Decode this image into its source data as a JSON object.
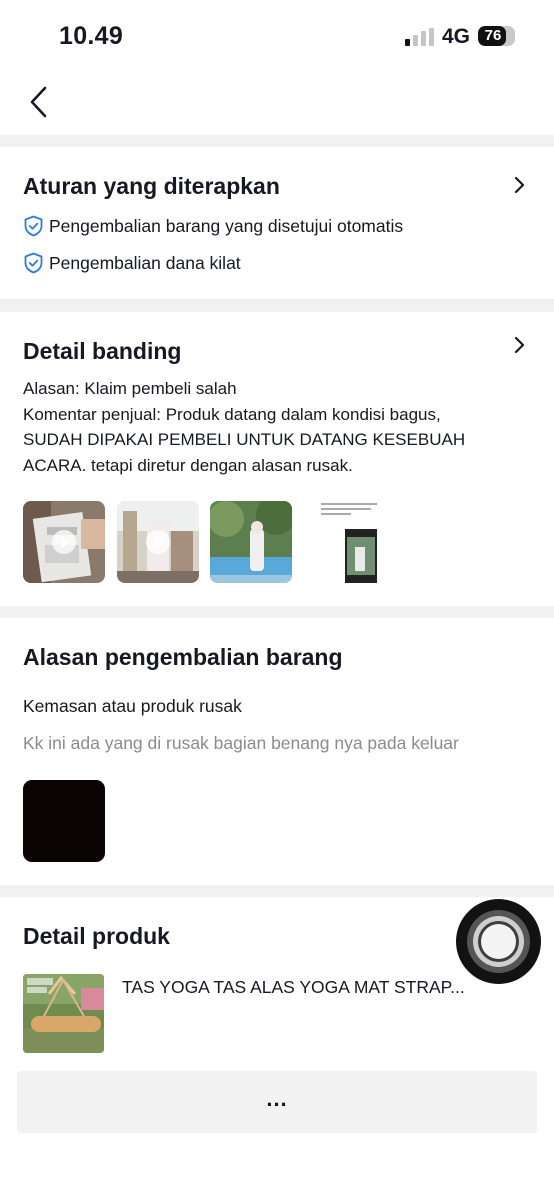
{
  "status_bar": {
    "time": "10.49",
    "network": "4G",
    "battery": "76",
    "battery_level": 0.76
  },
  "colors": {
    "accent_blue": "#2e7be0",
    "text": "#161823",
    "muted": "#8a8b91"
  },
  "rules_card": {
    "title": "Aturan yang diterapkan",
    "items": [
      {
        "icon": "shield-check-icon",
        "label": "Pengembalian barang yang disetujui otomatis"
      },
      {
        "icon": "shield-check-icon",
        "label": "Pengembalian dana kilat"
      }
    ]
  },
  "appeal_card": {
    "title": "Detail banding",
    "reason": "Alasan: Klaim pembeli salah",
    "comment_line1": "Komentar penjual: Produk datang dalam kondisi bagus,",
    "comment_line2": "SUDAH DIPAKAI PEMBELI UNTUK DATANG KESEBUAH",
    "comment_line3": "ACARA. tetapi diretur dengan alasan rusak.",
    "attachments": [
      {
        "type": "video",
        "icon": "play-icon"
      },
      {
        "type": "video",
        "icon": "play-icon"
      },
      {
        "type": "image"
      },
      {
        "type": "image"
      }
    ]
  },
  "return_reason_card": {
    "title": "Alasan pengembalian barang",
    "reason": "Kemasan atau produk rusak",
    "comment": "Kk ini ada yang di rusak bagian benang nya pada keluar"
  },
  "product_card": {
    "title": "Detail produk",
    "product_name": "TAS YOGA TAS ALAS YOGA MAT STRAP...",
    "more_label": "..."
  }
}
